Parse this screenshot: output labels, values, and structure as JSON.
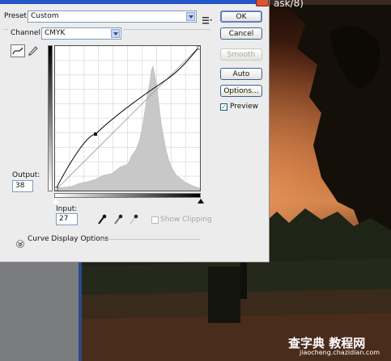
{
  "dialog": {
    "preset_label": "Preset:",
    "preset_value": "Custom",
    "channel_label": "Channel:",
    "channel_value": "CMYK",
    "output_label": "Output:",
    "output_value": "38",
    "input_label": "Input:",
    "input_value": "27",
    "show_clipping_label": "Show Clipping",
    "show_clipping_checked": false,
    "preview_label": "Preview",
    "preview_checked": true,
    "curve_display_options_label": "Curve Display Options",
    "buttons": {
      "ok": "OK",
      "cancel": "Cancel",
      "smooth": "Smooth",
      "auto": "Auto",
      "options": "Options..."
    }
  },
  "background": {
    "photo_title": "ask/8)",
    "watermark_main": "查字典 教程网",
    "watermark_url": "jiaocheng.chazidian.com"
  },
  "icons": {
    "preset_menu": "preset-options-icon",
    "curve_tool": "curve-tool-icon",
    "pencil_tool": "pencil-tool-icon",
    "black_point": "black-eyedropper-icon",
    "gray_point": "gray-eyedropper-icon",
    "white_point": "white-eyedropper-icon",
    "expand": "expand-chevron-icon"
  },
  "colors": {
    "dialog_bg": "#ececec",
    "accent": "#2457c5",
    "curve": "#000000",
    "histogram": "#c8c8c8",
    "sky_glow": "#c97a45"
  }
}
